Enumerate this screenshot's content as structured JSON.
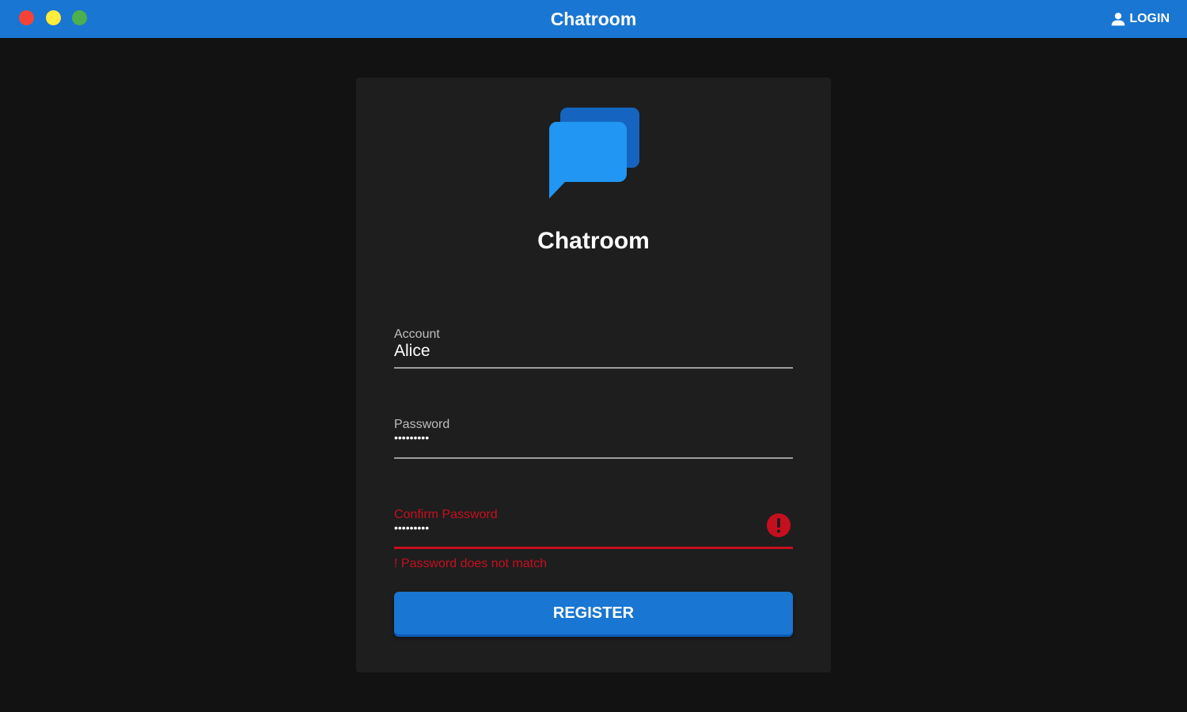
{
  "window": {
    "title": "Chatroom",
    "login_label": "LOGIN",
    "traffic_lights": [
      "#f44336",
      "#ffeb3b",
      "#4caf50"
    ]
  },
  "card": {
    "title": "Chatroom",
    "logo_icon": "chat-bubbles-icon"
  },
  "form": {
    "account": {
      "label": "Account",
      "value": "Alice"
    },
    "password": {
      "label": "Password",
      "value": "•••••••••"
    },
    "confirm_password": {
      "label": "Confirm Password",
      "value": "•••••••••",
      "error_icon": "exclamation-icon"
    },
    "error_message": "! Password does not match",
    "register_label": "REGISTER"
  },
  "colors": {
    "accent": "#1976d2",
    "error": "#c50f1f",
    "background": "#121212",
    "card": "#1e1e1e"
  }
}
